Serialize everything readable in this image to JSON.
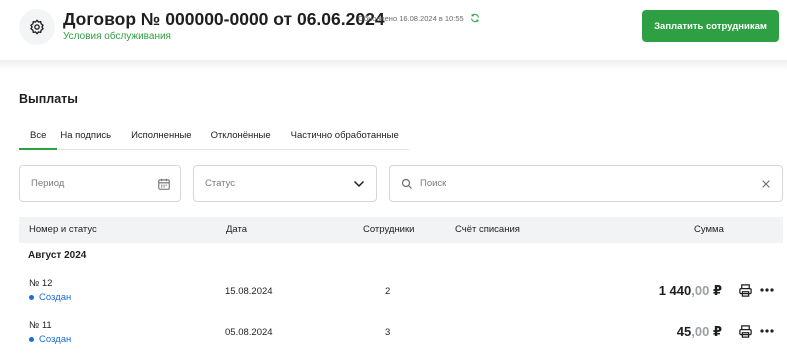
{
  "header": {
    "title": "Договор № 000000-0000 от 06.06.2024",
    "subtitle": "Условия обслуживания",
    "updated": "Обновлено 16.08.2024 в 10:55",
    "pay_button": "Заплатить сотрудникам",
    "icons": {
      "settings": "gear-icon",
      "refresh": "refresh-icon"
    }
  },
  "section": {
    "title": "Выплаты"
  },
  "tabs": [
    {
      "label": "Все",
      "active": true
    },
    {
      "label": "На подпись",
      "active": false
    },
    {
      "label": "Исполненные",
      "active": false
    },
    {
      "label": "Отклонённые",
      "active": false
    },
    {
      "label": "Частично обработанные",
      "active": false
    }
  ],
  "filters": {
    "period": {
      "placeholder": "Период",
      "icon": "calendar-icon"
    },
    "status": {
      "placeholder": "Статус",
      "icon": "chevron-down-icon"
    },
    "search": {
      "placeholder": "Поиск",
      "icon": "search-icon",
      "clear_icon": "close-icon"
    }
  },
  "table": {
    "columns": [
      "Номер и статус",
      "Дата",
      "Сотрудники",
      "Счёт списания",
      "Сумма"
    ],
    "group": "Август 2024",
    "rows": [
      {
        "number": "№ 12",
        "status": "Создан",
        "date": "15.08.2024",
        "employees": "2",
        "amount_int": "1 440",
        "amount_cents": ",00",
        "currency": "₽"
      },
      {
        "number": "№ 11",
        "status": "Создан",
        "date": "05.08.2024",
        "employees": "3",
        "amount_int": "45",
        "amount_cents": ",00",
        "currency": "₽"
      }
    ]
  },
  "colors": {
    "accent": "#2ea043",
    "status": "#1a6fd4",
    "header_bg": "#f2f3f5"
  }
}
